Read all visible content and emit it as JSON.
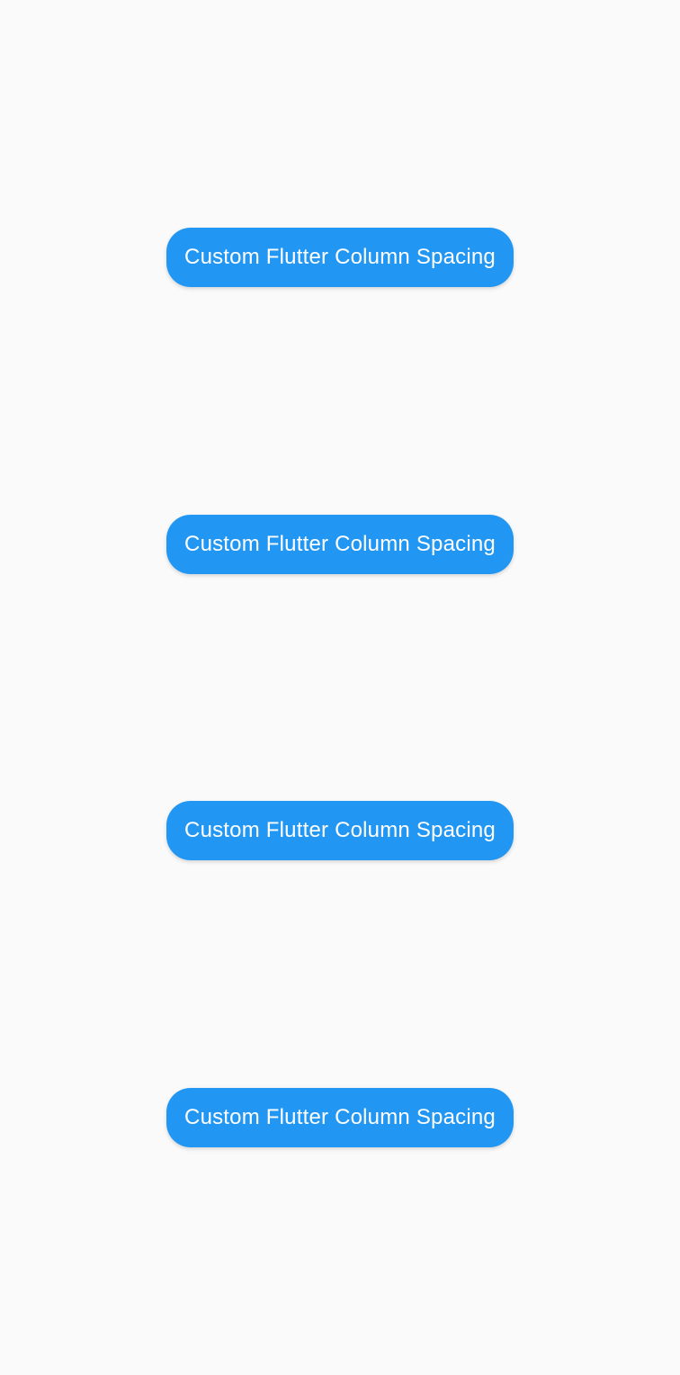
{
  "buttons": [
    {
      "label": "Custom Flutter Column Spacing"
    },
    {
      "label": "Custom Flutter Column Spacing"
    },
    {
      "label": "Custom Flutter Column Spacing"
    },
    {
      "label": "Custom Flutter Column Spacing"
    }
  ],
  "colors": {
    "background": "#fafafa",
    "button_bg": "#2196F3",
    "button_text": "#ffffff"
  }
}
